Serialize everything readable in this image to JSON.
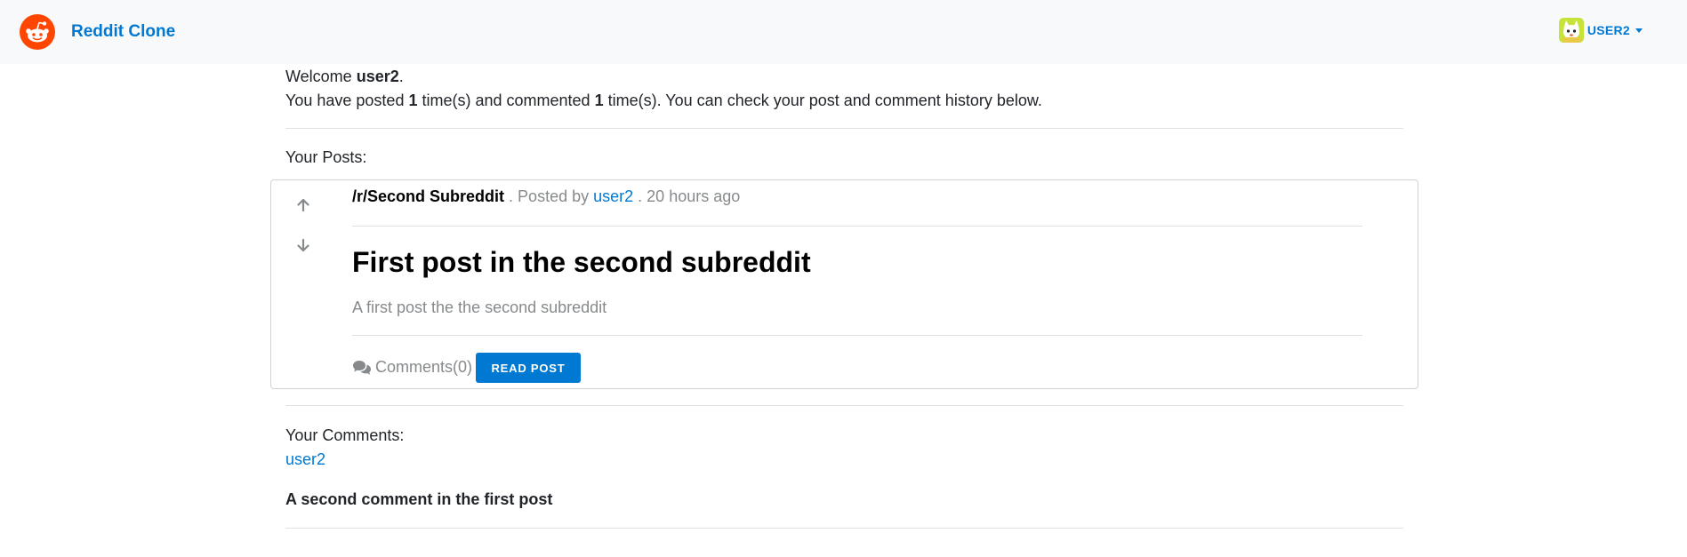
{
  "navbar": {
    "brand_name": "Reddit Clone",
    "logo_icon": "reddit-logo-icon",
    "user": {
      "name": "USER2",
      "avatar_icon": "user-avatar-icon",
      "dropdown_icon": "caret-down-icon"
    }
  },
  "welcome": {
    "greeting": "Welcome",
    "username": "user2",
    "period": ".",
    "posted_prefix": "You have posted",
    "post_count": "1",
    "commented_prefix": "time(s) and commented",
    "comment_count": "1",
    "suffix": "time(s). You can check your post and comment history below."
  },
  "posts_section": {
    "label": "Your Posts:",
    "posts": [
      {
        "subreddit": "/r/Second Subreddit",
        "posted_by_prefix": ". Posted by",
        "author": "user2",
        "time": ". 20 hours ago",
        "title": "First post in the second subreddit",
        "description": "A first post the the second subreddit",
        "comments_label": "Comments(0)",
        "read_button": "READ POST",
        "upvote_icon": "arrow-up-icon",
        "downvote_icon": "arrow-down-icon",
        "comments_icon": "comments-icon"
      }
    ]
  },
  "comments_section": {
    "label": "Your Comments:",
    "comments": [
      {
        "author": "user2",
        "text": "A second comment in the first post"
      }
    ]
  },
  "colors": {
    "accent": "#0079d3",
    "reddit_orange": "#ff4500",
    "muted_text": "#878a8c",
    "navbar_bg": "#f8f9fa",
    "divider": "#dee2e6"
  }
}
